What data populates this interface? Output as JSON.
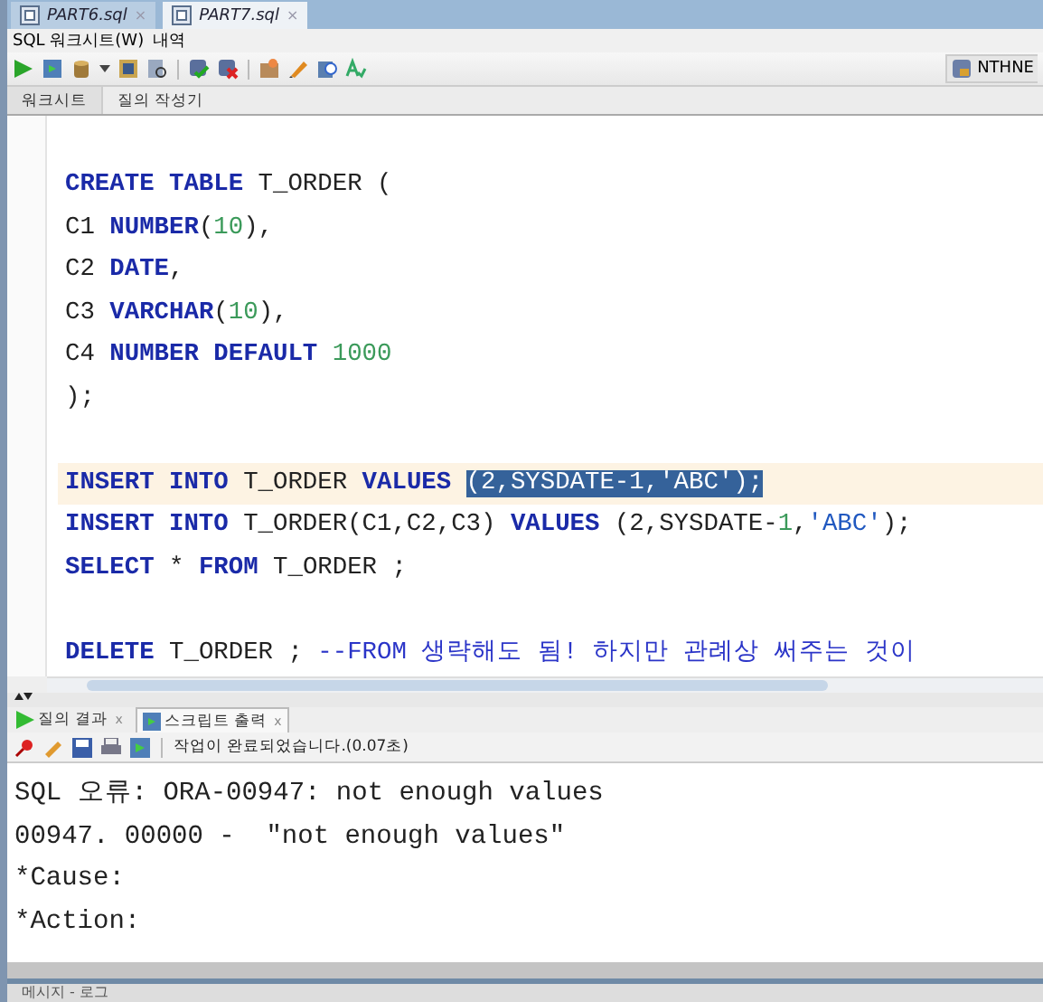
{
  "file_tabs": [
    {
      "label": "PART6.sql",
      "close": "×",
      "selected": false
    },
    {
      "label": "PART7.sql",
      "close": "×",
      "selected": true
    }
  ],
  "menu": [
    "SQL 워크시트(W)",
    "내역"
  ],
  "connection": "NTHNE",
  "sub_tabs": [
    {
      "label": "워크시트",
      "selected": true
    },
    {
      "label": "질의 작성기",
      "selected": false
    }
  ],
  "code_lines": [
    {
      "current": false,
      "tokens": [
        {
          "kind": "kw",
          "text": "CREATE TABLE"
        },
        {
          "kind": "plain",
          "text": " T_ORDER ("
        }
      ]
    },
    {
      "current": false,
      "tokens": [
        {
          "kind": "plain",
          "text": "C1 "
        },
        {
          "kind": "kw",
          "text": "NUMBER"
        },
        {
          "kind": "plain",
          "text": "("
        },
        {
          "kind": "num",
          "text": "10"
        },
        {
          "kind": "plain",
          "text": "),"
        }
      ]
    },
    {
      "current": false,
      "tokens": [
        {
          "kind": "plain",
          "text": "C2 "
        },
        {
          "kind": "kw",
          "text": "DATE"
        },
        {
          "kind": "plain",
          "text": ","
        }
      ]
    },
    {
      "current": false,
      "tokens": [
        {
          "kind": "plain",
          "text": "C3 "
        },
        {
          "kind": "kw",
          "text": "VARCHAR"
        },
        {
          "kind": "plain",
          "text": "("
        },
        {
          "kind": "num",
          "text": "10"
        },
        {
          "kind": "plain",
          "text": "),"
        }
      ]
    },
    {
      "current": false,
      "tokens": [
        {
          "kind": "plain",
          "text": "C4 "
        },
        {
          "kind": "kw",
          "text": "NUMBER DEFAULT "
        },
        {
          "kind": "num",
          "text": "1000"
        }
      ]
    },
    {
      "current": false,
      "tokens": [
        {
          "kind": "plain",
          "text": ");"
        }
      ]
    },
    {
      "current": false
    },
    {
      "current": true,
      "tokens": [
        {
          "kind": "kw",
          "text": "INSERT INTO"
        },
        {
          "kind": "plain",
          "text": " T_ORDER "
        },
        {
          "kind": "kw",
          "text": "VALUES "
        },
        {
          "kind": "sel",
          "text": "(2,SYSDATE-1,'ABC');"
        }
      ]
    },
    {
      "current": false,
      "tokens": [
        {
          "kind": "kw",
          "text": "INSERT INTO"
        },
        {
          "kind": "plain",
          "text": " T_ORDER(C1,C2,C3) "
        },
        {
          "kind": "kw",
          "text": "VALUES"
        },
        {
          "kind": "plain",
          "text": " (2,SYSDATE-"
        },
        {
          "kind": "num",
          "text": "1"
        },
        {
          "kind": "plain",
          "text": ","
        },
        {
          "kind": "str",
          "text": "'ABC'"
        },
        {
          "kind": "plain",
          "text": ");"
        }
      ]
    },
    {
      "current": false,
      "tokens": [
        {
          "kind": "kw",
          "text": "SELECT"
        },
        {
          "kind": "plain",
          "text": " * "
        },
        {
          "kind": "kw",
          "text": "FROM"
        },
        {
          "kind": "plain",
          "text": " T_ORDER ;"
        }
      ]
    },
    {
      "current": false
    },
    {
      "current": false,
      "tokens": [
        {
          "kind": "kw",
          "text": "DELETE"
        },
        {
          "kind": "plain",
          "text": " T_ORDER ; "
        },
        {
          "kind": "comment",
          "text": "--FROM 생략해도 됨! 하지만 관례상 써주는 것이"
        }
      ]
    }
  ],
  "result_tabs": [
    {
      "label": "질의 결과",
      "close": "x",
      "selected": false,
      "kind": "results"
    },
    {
      "label": "스크립트 출력",
      "close": "x",
      "selected": true,
      "kind": "script"
    }
  ],
  "status_message": "작업이 완료되었습니다.(0.07초)",
  "output_lines": [
    "SQL 오류: ORA-00947: not enough values",
    "00947. 00000 -  \"not enough values\"",
    "*Cause:",
    "*Action:"
  ],
  "bottom_tab": "메시지 - 로그"
}
